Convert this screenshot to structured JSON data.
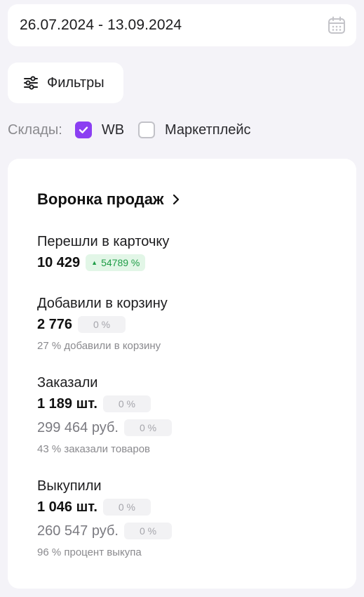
{
  "date_range": {
    "value": "26.07.2024 - 13.09.2024"
  },
  "filters": {
    "label": "Фильтры"
  },
  "warehouses": {
    "label": "Склады:",
    "options": [
      {
        "label": "WB",
        "checked": true
      },
      {
        "label": "Маркетплейс",
        "checked": false
      }
    ]
  },
  "funnel": {
    "title": "Воронка продаж",
    "visits": {
      "label": "Перешли в карточку",
      "value": "10 429",
      "change": "54789 %"
    },
    "cart": {
      "label": "Добавили в корзину",
      "value": "2 776",
      "change": "0 %",
      "note": "27 % добавили в корзину"
    },
    "orders": {
      "label": "Заказали",
      "qty": "1 189 шт.",
      "qty_change": "0 %",
      "sum": "299 464 руб.",
      "sum_change": "0 %",
      "note": "43 % заказали товаров"
    },
    "buyouts": {
      "label": "Выкупили",
      "qty": "1 046 шт.",
      "qty_change": "0 %",
      "sum": "260 547 руб.",
      "sum_change": "0 %",
      "note": "96 % процент выкупа"
    }
  },
  "colors": {
    "accent": "#8b3ff2",
    "positive": "#1f9d47",
    "positive_bg": "#e2f6e7",
    "background": "#f4f3f8"
  }
}
